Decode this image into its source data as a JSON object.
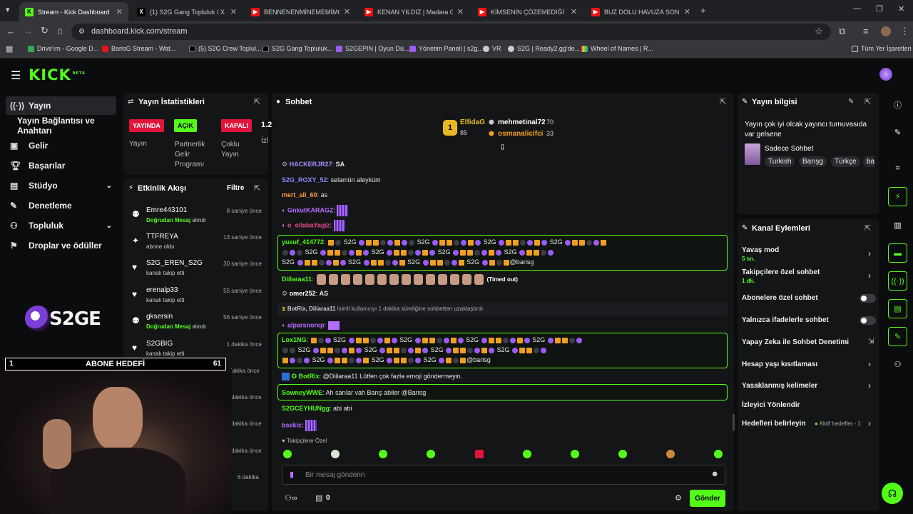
{
  "browser": {
    "tabs": [
      {
        "title": "Stream - Kick Dashboard",
        "icon": "kick-icon",
        "active": true
      },
      {
        "title": "(1) S2G Gang Topluluk / X",
        "icon": "x-icon"
      },
      {
        "title": "BENNENENMİNEMEMİMOMAN",
        "icon": "youtube-icon"
      },
      {
        "title": "KENAN YILDIZ | Madara Olduğ",
        "icon": "youtube-icon"
      },
      {
        "title": "KİMSENİN ÇÖZEMEDİĞİ TARİH",
        "icon": "youtube-icon"
      },
      {
        "title": "BUZ DOLU HAVUZA SON DÜŞE",
        "icon": "youtube-icon"
      }
    ],
    "url": "dashboard.kick.com/stream",
    "bookmarks": [
      "Drive'ım - Google D...",
      "BarisG Stream - Wat...",
      "(5) S2G Crew Toplul...",
      "S2G Gang Topluluk...",
      "S2GEPIN | Oyun Dü...",
      "Yönetim Paneli | s2g...",
      "VR",
      "S2G | Ready2.gg'de...",
      "Wheel of Names | R..."
    ],
    "bookmarks_other": "Tüm Yer İşaretleri"
  },
  "kick": {
    "logo": "KICK",
    "beta": "BETA"
  },
  "sidebar": {
    "items": [
      {
        "label": "Yayın",
        "icon": "broadcast-icon"
      },
      {
        "label": "Yayın Bağlantısı ve Anahtarı",
        "icon": ""
      },
      {
        "label": "Gelir",
        "icon": "dollar-icon"
      },
      {
        "label": "Başarılar",
        "icon": "trophy-icon"
      },
      {
        "label": "Stüdyo",
        "icon": "studio-icon"
      },
      {
        "label": "Denetleme",
        "icon": "wrench-icon"
      },
      {
        "label": "Topluluk",
        "icon": "people-icon"
      },
      {
        "label": "Droplar ve ödüller",
        "icon": "gift-icon"
      }
    ]
  },
  "stats": {
    "title": "Yayın İstatistikleri",
    "badges": [
      {
        "label": "YAYINDA",
        "caption": "Yayın"
      },
      {
        "label": "AÇIK",
        "caption": "Partnerlik Gelir Programı"
      },
      {
        "label": "KAPALI",
        "caption": "Çoklu Yayın"
      }
    ],
    "partial_value": "1.2",
    "partial_caption": "İzl"
  },
  "feed": {
    "title": "Etkinlik Akışı",
    "filter": "Filtre",
    "items": [
      {
        "name": "Emre443101",
        "desc": "Doğrudan Mesaj",
        "desc2": " alındı",
        "time": "8 saniye önce",
        "icon": "gift-icon"
      },
      {
        "name": "TTFREYA",
        "desc": "",
        "desc2": "abone oldu",
        "time": "13 saniye önce",
        "icon": "sparkle-icon"
      },
      {
        "name": "S2G_EREN_S2G",
        "desc": "",
        "desc2": "kanalı takip etti",
        "time": "30 saniye önce",
        "icon": "heart-icon"
      },
      {
        "name": "erenalp33",
        "desc": "",
        "desc2": "kanalı takip etti",
        "time": "55 saniye önce",
        "icon": "heart-icon"
      },
      {
        "name": "gksersin",
        "desc": "Doğrudan Mesaj",
        "desc2": " alındı",
        "time": "56 saniye önce",
        "icon": "gift-icon"
      },
      {
        "name": "S2GBIG",
        "desc": "",
        "desc2": "kanalı takip etti",
        "time": "1 dakika önce",
        "icon": "heart-icon"
      }
    ],
    "more_times": [
      "dakika önce",
      "dakika önce",
      "dakika önce",
      "dakika önce",
      "6 dakika"
    ]
  },
  "overlay": {
    "goal_label": "ABONE HEDEFİ",
    "goal_left": "1",
    "goal_right": "61",
    "logo": "S2GE"
  },
  "chat": {
    "title": "Sohbet",
    "top": [
      {
        "name": "ElfidaG",
        "value": "85"
      },
      {
        "name": "mehmetinal72",
        "value": "70"
      },
      {
        "name": "osmanalicifci",
        "value": "33"
      }
    ],
    "rank_badge": "1",
    "messages": [
      {
        "user": "HACKERJR27",
        "text": "SA",
        "color": "#a98bff"
      },
      {
        "user": "S2G_ROXY_52",
        "text": "selamün aleyküm",
        "color": "#8b8bff"
      },
      {
        "user": "mert_ali_60",
        "text": "as",
        "color": "#ff9a3c"
      },
      {
        "user": "GnkutKARAGZ",
        "text": "",
        "color": "#b56cff"
      },
      {
        "user": "o_ollabaYagiz",
        "text": "",
        "color": "#e04a8a"
      },
      {
        "user": "yusuf_414772",
        "text": "S2G",
        "color": "#53fc18"
      },
      {
        "user": "Diilaraa11",
        "text": "(Timed out)",
        "color": "#53fc18"
      },
      {
        "user": "omer252",
        "text": "AS",
        "color": "#ffffff"
      },
      {
        "user": "BotRix, Diilaraa11",
        "text": "isimli kullanıcıyı 1 dakika süreliğine sohbetten uzaklaştırdı",
        "color": "#aaaaaa"
      },
      {
        "user": "alparsnorep",
        "text": "",
        "color": "#b56cff"
      },
      {
        "user": "Lox1NG",
        "text": "S2G",
        "color": "#53fc18"
      },
      {
        "user": "BotRix",
        "text": "@Diilaraa11 Lütfen çok fazla emoji göndermeyin.",
        "color": "#53fc18"
      },
      {
        "user": "SowneyWWE",
        "text": "Ah sarılar vah Barış abiler @Barisg",
        "color": "#53fc18"
      },
      {
        "user": "S2GCEYHUNgg",
        "text": "abi abi",
        "color": "#53fc18"
      },
      {
        "user": "bsekic",
        "text": "",
        "color": "#b56cff"
      }
    ],
    "mention": "@barisg",
    "followers_only": "Takipçilere Özel",
    "input_placeholder": "Bir mesaj gönderin",
    "count": "0",
    "send": "Gönder"
  },
  "info": {
    "title": "Yayın bilgisi",
    "stream_title": "Yayın çok iyi olcak yayıncı turnuvasıda var gelsene",
    "category": "Sadece Sohbet",
    "tags": [
      "Turkish",
      "Barışg",
      "Türkçe",
      "ba"
    ]
  },
  "actions": {
    "title": "Kanal Eylemleri",
    "items": [
      {
        "label": "Yavaş mod",
        "sub": "5 sn.",
        "kind": "chevron"
      },
      {
        "label": "Takipçilere özel sohbet",
        "sub": "1 dk.",
        "kind": "chevron"
      },
      {
        "label": "Abonelere özel sohbet",
        "sub": "",
        "kind": "toggle"
      },
      {
        "label": "Yalnızca ifadelerle sohbet",
        "sub": "",
        "kind": "toggle"
      },
      {
        "label": "Yapay Zeka ile Sohbet Denetimi",
        "sub": "",
        "kind": "external"
      },
      {
        "label": "Hesap yaşı kısıtlaması",
        "sub": "",
        "kind": "chevron"
      },
      {
        "label": "Yasaklanmış kelimeler",
        "sub": "",
        "kind": "chevron"
      },
      {
        "label": "İzleyici Yönlendir",
        "sub": "",
        "kind": "none"
      },
      {
        "label": "Hedefleri belirleyin",
        "sub": "",
        "kind": "chevron"
      }
    ],
    "goal_status": "Aktif hedefler - 1"
  },
  "colors": {
    "accent": "#53fc18",
    "bg": "#0b0c0d",
    "panel": "#141517",
    "live": "#e1143c"
  }
}
